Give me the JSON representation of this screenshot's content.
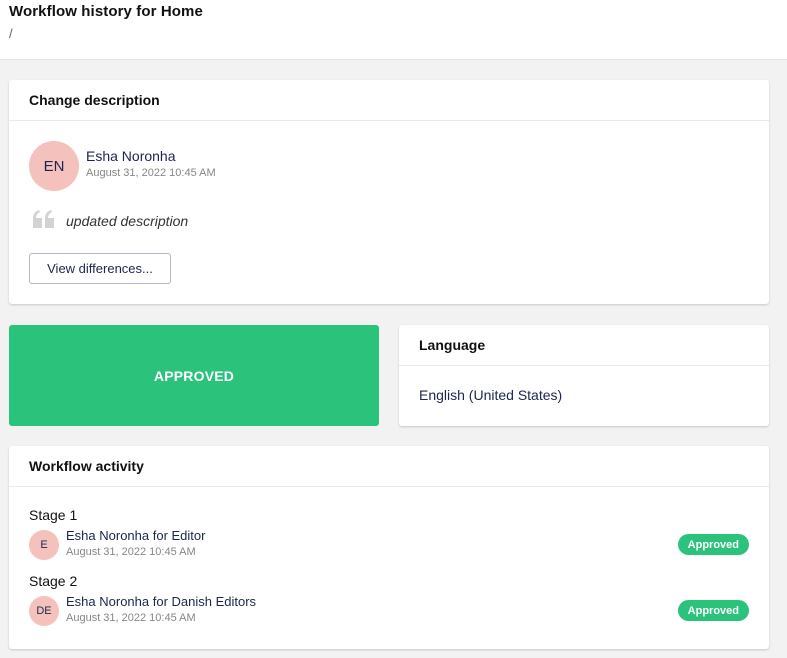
{
  "header": {
    "title": "Workflow history for Home",
    "breadcrumb": "/"
  },
  "change_card": {
    "title": "Change description",
    "author": {
      "initials": "EN",
      "name": "Esha Noronha",
      "date": "August 31, 2022 10:45 AM"
    },
    "quote_icon": "quote-icon",
    "comment": "updated description",
    "view_button": "View differences..."
  },
  "status": {
    "label": "APPROVED",
    "color": "#2bc37c"
  },
  "language_card": {
    "title": "Language",
    "value": "English (United States)"
  },
  "activity_card": {
    "title": "Workflow activity",
    "stages": [
      {
        "label": "Stage 1",
        "initials": "E",
        "name": "Esha Noronha for Editor",
        "date": "August 31, 2022 10:45 AM",
        "status": "Approved"
      },
      {
        "label": "Stage 2",
        "initials": "DE",
        "name": "Esha Noronha for Danish Editors",
        "date": "August 31, 2022 10:45 AM",
        "status": "Approved"
      }
    ]
  },
  "colors": {
    "accent_green": "#2bc37c",
    "avatar_bg": "#f5c1bc",
    "text_navy": "#1b264f"
  }
}
